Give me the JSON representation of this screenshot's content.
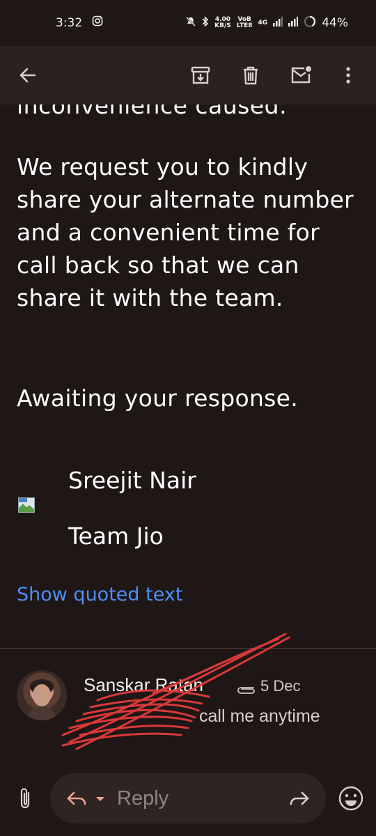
{
  "status_bar": {
    "time": "3:32",
    "net_speed_top": "4.00",
    "net_speed_unit": "KB/S",
    "volte_top": "VoB",
    "volte_bottom": "LTE8",
    "network": "4G",
    "battery": "44%"
  },
  "toolbar": {
    "back_icon": "arrow-left-icon",
    "archive_icon": "archive-icon",
    "delete_icon": "trash-icon",
    "mark_unread_icon": "mail-unread-icon",
    "more_icon": "more-vert-icon"
  },
  "email": {
    "cut_off_line": "inconvenience caused.",
    "paragraph1": "We request you to kindly share your alternate number and a convenient time for call back so that we can share it with the team.",
    "paragraph2": "Awaiting your response.",
    "signature_name": "Sreejit Nair",
    "signature_team": "Team Jio",
    "show_quoted": "Show quoted text"
  },
  "message": {
    "sender": "Sanskar Ratan",
    "date": "5 Dec",
    "snippet": "call me anytime"
  },
  "reply_bar": {
    "reply_label": "Reply"
  },
  "colors": {
    "background": "#1e1716",
    "toolbar": "#2a2221",
    "link": "#4e8df6",
    "reply_accent": "#f0a38e",
    "scribble": "#e23b3b"
  }
}
